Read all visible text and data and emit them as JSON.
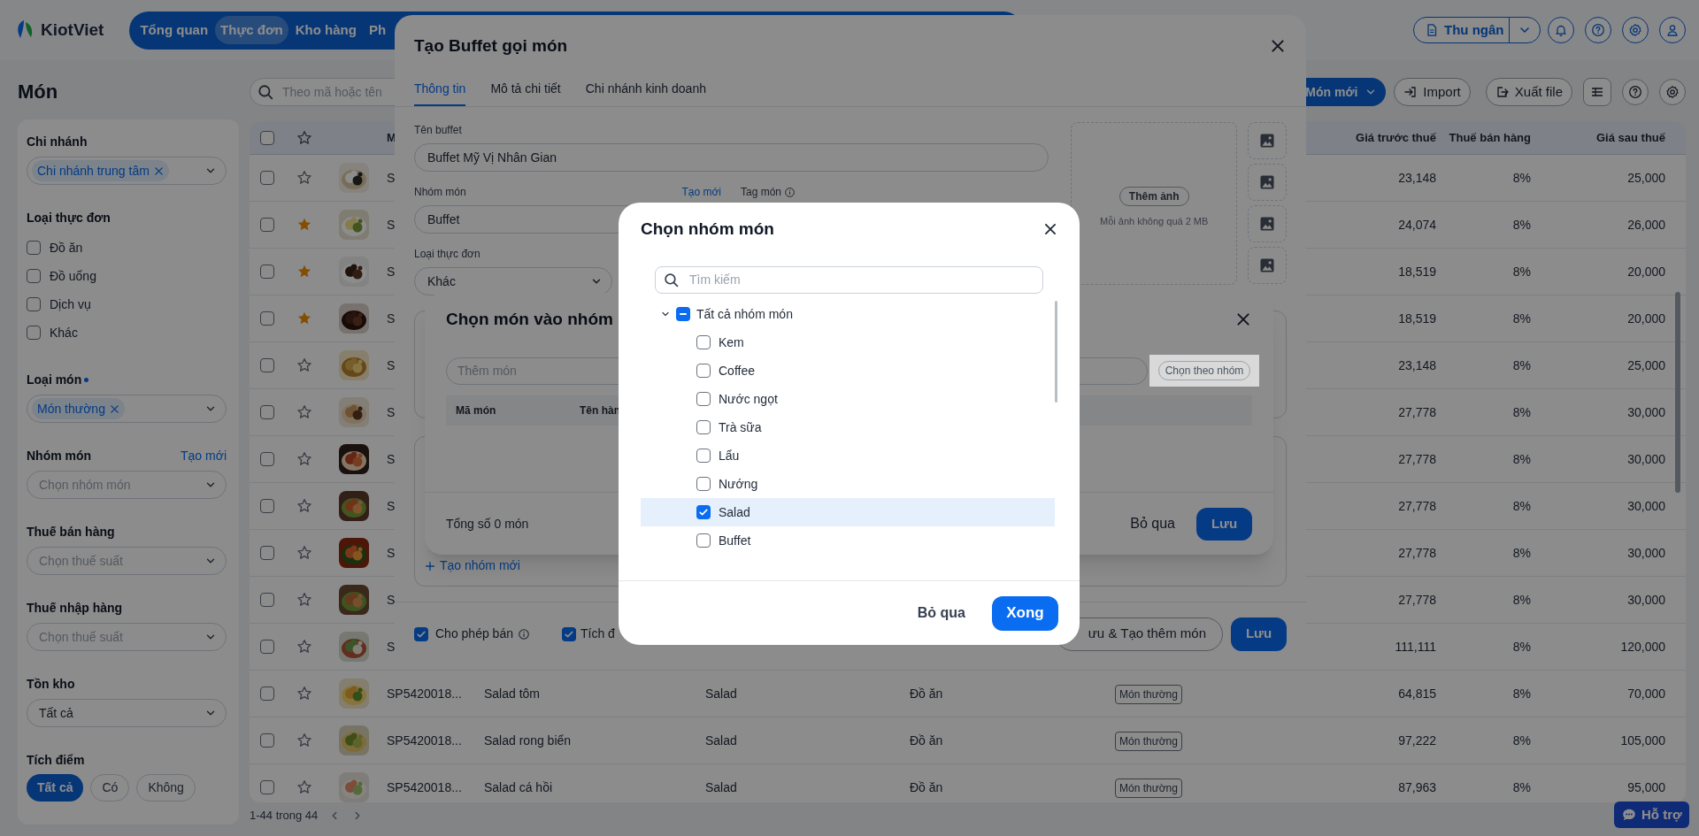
{
  "top_nav": {
    "logo": "KiotViet",
    "items": [
      {
        "label": "Tổng quan",
        "selected": false
      },
      {
        "label": "Thực đơn",
        "selected": true
      },
      {
        "label": "Kho hàng",
        "selected": false
      },
      {
        "label": "Ph",
        "selected": false
      }
    ],
    "cashier_button": "Thu ngân"
  },
  "page": {
    "title": "Món",
    "search_placeholder": "Theo mã hoặc tên",
    "new_button": "Món mới",
    "import_button": "Import",
    "export_button": "Xuất file"
  },
  "sidebar": {
    "sections": [
      {
        "kind": "select",
        "label": "Chi nhánh",
        "chips": [
          "Chi nhánh trung tâm"
        ]
      },
      {
        "kind": "checkboxes",
        "label": "Loại thực đơn",
        "options": [
          {
            "label": "Đồ ăn",
            "checked": false
          },
          {
            "label": "Đồ uống",
            "checked": false
          },
          {
            "label": "Dịch vụ",
            "checked": false
          },
          {
            "label": "Khác",
            "checked": false
          }
        ]
      },
      {
        "kind": "select",
        "label": "Loại món",
        "required": true,
        "chips": [
          "Món thường"
        ]
      },
      {
        "kind": "select",
        "label": "Nhóm món",
        "link": "Tạo mới",
        "placeholder": "Chọn nhóm món"
      },
      {
        "kind": "select",
        "label": "Thuế bán hàng",
        "placeholder": "Chọn thuế suất"
      },
      {
        "kind": "select",
        "label": "Thuế nhập hàng",
        "placeholder": "Chọn thuế suất"
      },
      {
        "kind": "select",
        "label": "Tồn kho",
        "value": "Tất cả"
      },
      {
        "kind": "pills",
        "label": "Tích điểm",
        "options": [
          {
            "label": "Tất cả",
            "selected": true
          },
          {
            "label": "Có",
            "selected": false
          },
          {
            "label": "Không",
            "selected": false
          }
        ]
      }
    ]
  },
  "table": {
    "header": {
      "checked": false,
      "code": "M",
      "price_before": "Giá trước thuế",
      "tax": "Thuế bán hàng",
      "price_after": "Giá sau thuế"
    },
    "rows": [
      {
        "checked": false,
        "starred": false,
        "code": "S",
        "price_before": "23,148",
        "tax": "8%",
        "price_after": "25,000"
      },
      {
        "checked": false,
        "starred": true,
        "code": "S",
        "price_before": "24,074",
        "tax": "8%",
        "price_after": "26,000"
      },
      {
        "checked": false,
        "starred": true,
        "code": "S",
        "price_before": "18,519",
        "tax": "8%",
        "price_after": "20,000"
      },
      {
        "checked": false,
        "starred": true,
        "code": "S",
        "price_before": "18,519",
        "tax": "8%",
        "price_after": "20,000"
      },
      {
        "checked": false,
        "starred": false,
        "code": "S",
        "price_before": "23,148",
        "tax": "8%",
        "price_after": "25,000"
      },
      {
        "checked": false,
        "starred": false,
        "code": "S",
        "price_before": "27,778",
        "tax": "8%",
        "price_after": "30,000"
      },
      {
        "checked": false,
        "starred": false,
        "code": "S",
        "price_before": "27,778",
        "tax": "8%",
        "price_after": "30,000"
      },
      {
        "checked": false,
        "starred": false,
        "code": "S",
        "price_before": "27,778",
        "tax": "8%",
        "price_after": "30,000"
      },
      {
        "checked": false,
        "starred": false,
        "code": "S",
        "price_before": "27,778",
        "tax": "8%",
        "price_after": "30,000"
      },
      {
        "checked": false,
        "starred": false,
        "code": "S",
        "price_before": "27,778",
        "tax": "8%",
        "price_after": "30,000"
      },
      {
        "checked": false,
        "starred": false,
        "code": "S",
        "price_before": "111,111",
        "tax": "8%",
        "price_after": "120,000"
      },
      {
        "checked": false,
        "starred": false,
        "code": "SP5420018...",
        "name": "Salad tôm",
        "group": "Salad",
        "menu_type": "Đồ ăn",
        "tag": "Món thường",
        "price_before": "64,815",
        "tax": "8%",
        "price_after": "70,000"
      },
      {
        "checked": false,
        "starred": false,
        "code": "SP5420018...",
        "name": "Salad rong biển",
        "group": "Salad",
        "menu_type": "Đồ ăn",
        "tag": "Món thường",
        "price_before": "97,222",
        "tax": "8%",
        "price_after": "105,000"
      },
      {
        "checked": false,
        "starred": false,
        "code": "SP5420018...",
        "name": "Salad cá hồi",
        "group": "Salad",
        "menu_type": "Đồ ăn",
        "tag": "Món thường",
        "price_before": "87,963",
        "tax": "8%",
        "price_after": "95,000"
      }
    ],
    "pagination": "1-44 trong 44"
  },
  "support_button": "Hỗ trợ",
  "buffet_modal": {
    "title": "Tạo Buffet gọi món",
    "tabs": [
      {
        "label": "Thông tin",
        "selected": true
      },
      {
        "label": "Mô tả chi tiết",
        "selected": false
      },
      {
        "label": "Chi nhánh kinh doanh",
        "selected": false
      }
    ],
    "name_label": "Tên buffet",
    "name_value": "Buffet Mỹ Vị Nhân Gian",
    "group_label": "Nhóm món",
    "group_link": "Tạo mới",
    "tag_label": "Tag món",
    "group_value": "Buffet",
    "menu_type_label": "Loại thực đơn",
    "menu_type_value": "Khác",
    "image_button": "Thêm ảnh",
    "image_hint": "Mỗi ảnh không quá 2 MB",
    "create_group_link": "Tạo nhóm mới",
    "options": [
      {
        "label": "Cho phép bán",
        "checked": true,
        "info": true
      },
      {
        "label": "Tích đ",
        "checked": true,
        "info": false
      }
    ],
    "save_more_button": "ưu & Tạo thêm món",
    "save_button": "Lưu"
  },
  "item_dialog": {
    "title": "Chọn món vào nhóm",
    "input_placeholder": "Thêm món",
    "group_button": "Chọn theo nhóm",
    "columns": [
      "Mã món",
      "Tên hàn"
    ],
    "total": "Tổng số 0 món",
    "cancel_button": "Bỏ qua",
    "save_button": "Lưu"
  },
  "group_picker": {
    "title": "Chọn nhóm món",
    "search_placeholder": "Tìm kiếm",
    "tree": [
      {
        "label": "Tất cả nhóm món",
        "expanded": true,
        "checked": false,
        "partial": true,
        "selected": false,
        "children": [
          {
            "label": "Kem",
            "checked": false,
            "selected": false
          },
          {
            "label": "Coffee",
            "checked": false,
            "selected": false
          },
          {
            "label": "Nước ngọt",
            "checked": false,
            "selected": false
          },
          {
            "label": "Trà sữa",
            "checked": false,
            "selected": false
          },
          {
            "label": "Lẩu",
            "checked": false,
            "selected": false
          },
          {
            "label": "Nướng",
            "checked": false,
            "selected": false
          },
          {
            "label": "Salad",
            "checked": true,
            "selected": true
          },
          {
            "label": "Buffet",
            "checked": false,
            "selected": false
          }
        ]
      }
    ],
    "cancel_button": "Bỏ qua",
    "done_button": "Xong"
  }
}
